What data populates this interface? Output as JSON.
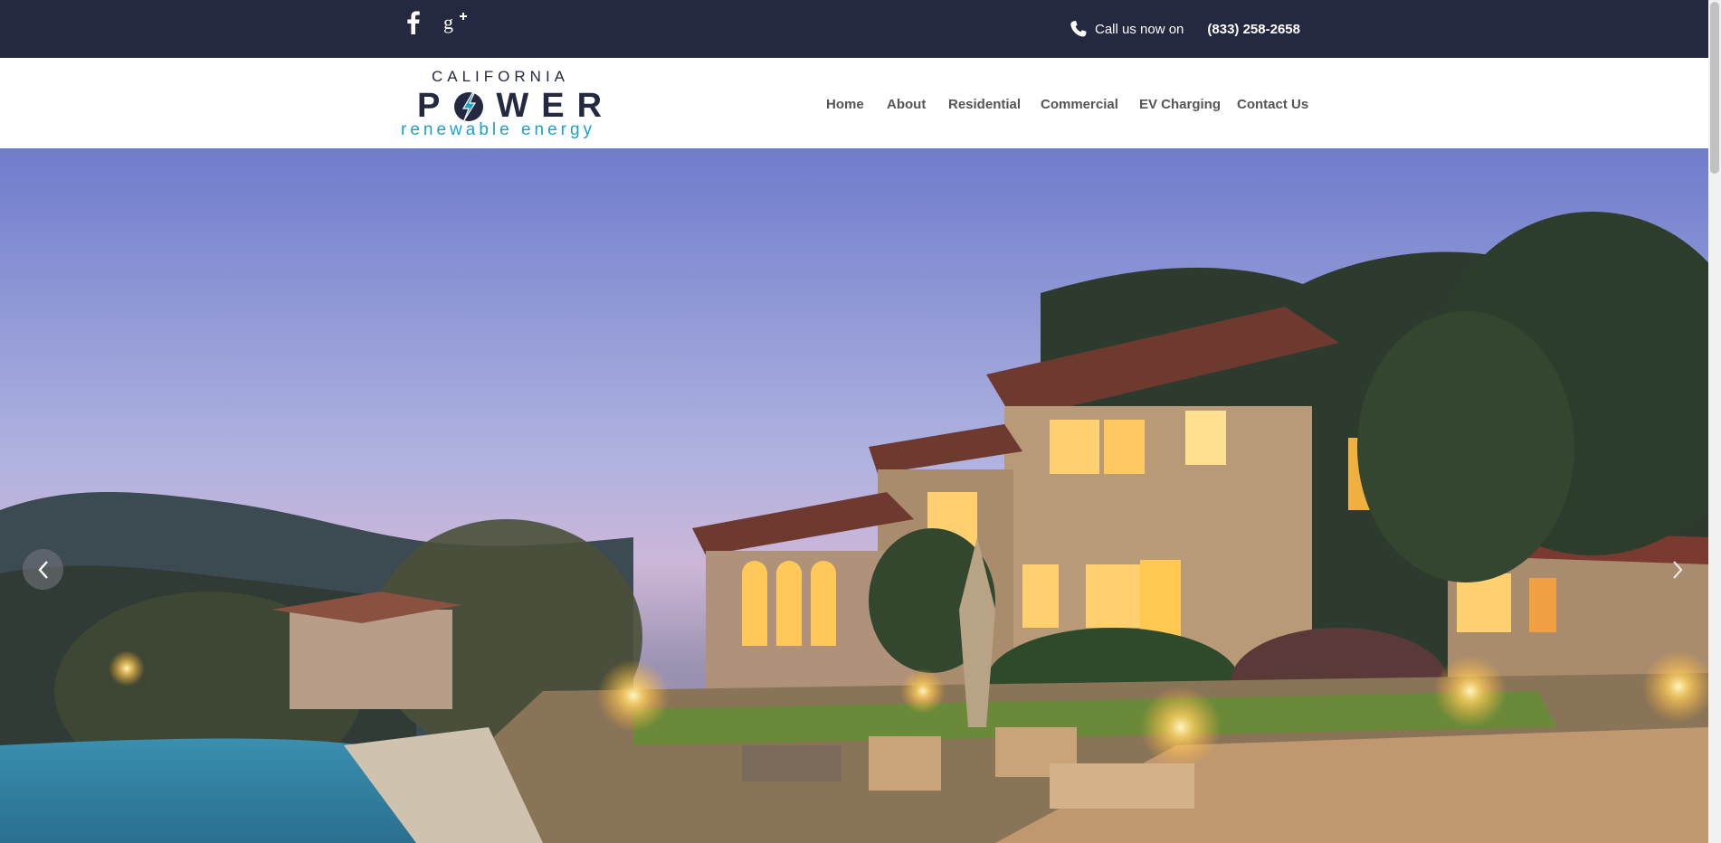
{
  "topbar": {
    "social": [
      {
        "icon": "facebook-icon",
        "glyph": "f"
      },
      {
        "icon": "google-plus-icon",
        "glyph": "g+"
      }
    ],
    "call_label": "Call us now on",
    "phone": "(833) 258-2658",
    "phone_icon": "phone-icon"
  },
  "logo": {
    "top": "CALIFORNIA",
    "main_left": "P",
    "main_right": "WER",
    "bottom": "renewable energy",
    "colors": {
      "navy": "#252841",
      "cyan": "#1aa1c8"
    }
  },
  "nav": {
    "items": [
      {
        "label": "Home"
      },
      {
        "label": "About"
      },
      {
        "label": "Residential"
      },
      {
        "label": "Commercial"
      },
      {
        "label": "EV Charging"
      },
      {
        "label": "Contact Us"
      }
    ]
  },
  "hero": {
    "prev_icon": "chevron-left-icon",
    "next_icon": "chevron-right-icon"
  },
  "colors": {
    "topbar_bg": "#252841",
    "nav_text": "#555555"
  }
}
